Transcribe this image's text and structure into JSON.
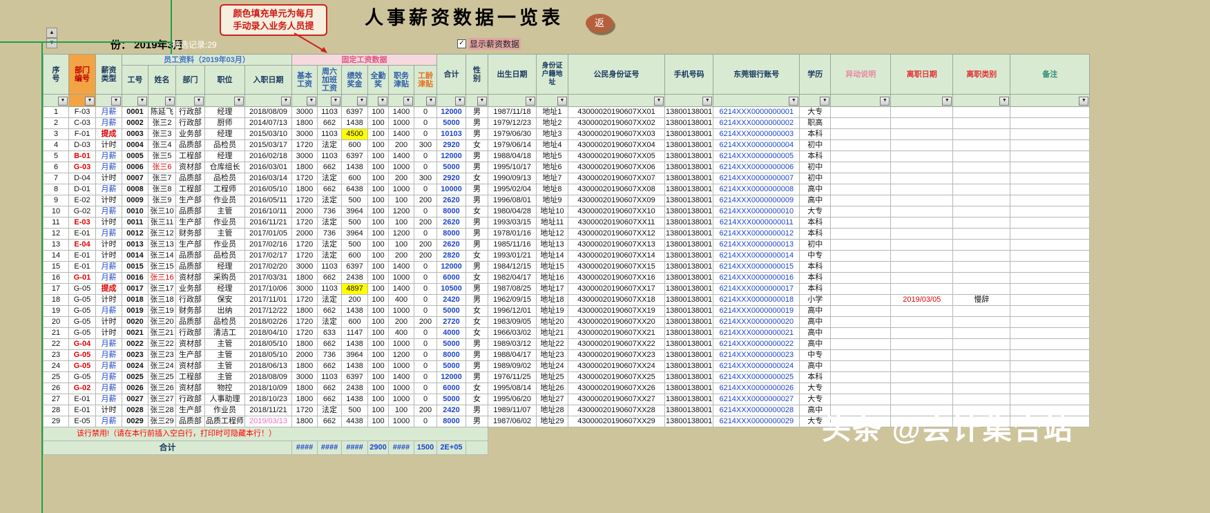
{
  "page": {
    "title": "人事薪资数据一览表",
    "return_button": "返",
    "watermark": "头条 @会计集合站",
    "callout": {
      "line1": "颜色填充单元为每月",
      "line2": "手动录入业务人员提"
    }
  },
  "controls": {
    "month_label": "份：  2019年3月",
    "filter_record": "筛选记录:29",
    "checkbox_label": "显示薪资数据",
    "checkbox_checked": true
  },
  "table": {
    "group_headers": {
      "employee": "员工资料（2019年03月）",
      "fixed_salary": "固定工资数据"
    },
    "columns": [
      "序\n号",
      "部门\n编号",
      "薪资\n类型",
      "工号",
      "姓名",
      "部门",
      "职位",
      "入职日期",
      "基本\n工资",
      "周六\n加班\n工资",
      "绩效\n奖金",
      "全勤\n奖",
      "职务\n津贴",
      "工龄\n津贴",
      "合计",
      "性\n别",
      "出生日期",
      "身份证\n户籍地\n址",
      "公民身份证号",
      "手机号码",
      "东莞银行账号",
      "学历",
      "异动说明",
      "离职日期",
      "离职类别",
      "备注"
    ],
    "rows": [
      [
        "1",
        "F-03",
        "月薪",
        "0001",
        "陈延飞",
        "行政部",
        "经理",
        "2018/08/09",
        "3000",
        "1103",
        "6397",
        "100",
        "1400",
        "0",
        "12000",
        "男",
        "1987/11/18",
        "地址1",
        "43000020190607XX01",
        "13800138001",
        "6214XXX0000000001",
        "大专",
        "",
        "",
        "",
        ""
      ],
      [
        "2",
        "C-03",
        "月薪",
        "0002",
        "张三2",
        "行政部",
        "厨师",
        "2014/07/13",
        "1800",
        "662",
        "1438",
        "100",
        "1000",
        "0",
        "5000",
        "男",
        "1979/12/23",
        "地址2",
        "43000020190607XX02",
        "13800138001",
        "6214XXX0000000002",
        "职高",
        "",
        "",
        "",
        ""
      ],
      [
        "3",
        "F-01",
        "提成",
        "0003",
        "张三3",
        "业务部",
        "经理",
        "2015/03/10",
        "3000",
        "1103",
        "4500",
        "100",
        "1400",
        "0",
        "10103",
        "男",
        "1979/06/30",
        "地址3",
        "43000020190607XX03",
        "13800138001",
        "6214XXX0000000003",
        "本科",
        "",
        "",
        "",
        ""
      ],
      [
        "4",
        "D-03",
        "计时",
        "0004",
        "张三4",
        "品质部",
        "品检员",
        "2015/03/17",
        "1720",
        "法定",
        "600",
        "100",
        "200",
        "300",
        "2920",
        "女",
        "1979/06/14",
        "地址4",
        "43000020190607XX04",
        "13800138001",
        "6214XXX0000000004",
        "初中",
        "",
        "",
        "",
        ""
      ],
      [
        "5",
        "B-01",
        "月薪",
        "0005",
        "张三5",
        "工程部",
        "经理",
        "2016/02/18",
        "3000",
        "1103",
        "6397",
        "100",
        "1400",
        "0",
        "12000",
        "男",
        "1988/04/18",
        "地址5",
        "43000020190607XX05",
        "13800138001",
        "6214XXX0000000005",
        "本科",
        "",
        "",
        "",
        ""
      ],
      [
        "6",
        "G-03",
        "月薪",
        "0006",
        "张三6",
        "资材部",
        "仓库组长",
        "2016/03/01",
        "1800",
        "662",
        "1438",
        "100",
        "1000",
        "0",
        "5000",
        "男",
        "1995/10/17",
        "地址6",
        "43000020190607XX06",
        "13800138001",
        "6214XXX0000000006",
        "初中",
        "",
        "",
        "",
        ""
      ],
      [
        "7",
        "D-04",
        "计时",
        "0007",
        "张三7",
        "品质部",
        "品检员",
        "2016/03/14",
        "1720",
        "法定",
        "600",
        "100",
        "200",
        "300",
        "2920",
        "女",
        "1990/09/13",
        "地址7",
        "43000020190607XX07",
        "13800138001",
        "6214XXX0000000007",
        "初中",
        "",
        "",
        "",
        ""
      ],
      [
        "8",
        "D-01",
        "月薪",
        "0008",
        "张三8",
        "工程部",
        "工程师",
        "2016/05/10",
        "1800",
        "662",
        "6438",
        "100",
        "1000",
        "0",
        "10000",
        "男",
        "1995/02/04",
        "地址8",
        "43000020190607XX08",
        "13800138001",
        "6214XXX0000000008",
        "高中",
        "",
        "",
        "",
        ""
      ],
      [
        "9",
        "E-02",
        "计时",
        "0009",
        "张三9",
        "生产部",
        "作业员",
        "2016/05/11",
        "1720",
        "法定",
        "500",
        "100",
        "100",
        "200",
        "2620",
        "男",
        "1996/08/01",
        "地址9",
        "43000020190607XX09",
        "13800138001",
        "6214XXX0000000009",
        "高中",
        "",
        "",
        "",
        ""
      ],
      [
        "10",
        "G-02",
        "月薪",
        "0010",
        "张三10",
        "品质部",
        "主管",
        "2016/10/11",
        "2000",
        "736",
        "3964",
        "100",
        "1200",
        "0",
        "8000",
        "女",
        "1980/04/28",
        "地址10",
        "43000020190607XX10",
        "13800138001",
        "6214XXX0000000010",
        "大专",
        "",
        "",
        "",
        ""
      ],
      [
        "11",
        "E-03",
        "计时",
        "0011",
        "张三11",
        "生产部",
        "作业员",
        "2016/11/21",
        "1720",
        "法定",
        "500",
        "100",
        "100",
        "200",
        "2620",
        "男",
        "1993/03/15",
        "地址11",
        "43000020190607XX11",
        "13800138001",
        "6214XXX0000000011",
        "本科",
        "",
        "",
        "",
        ""
      ],
      [
        "12",
        "E-01",
        "月薪",
        "0012",
        "张三12",
        "财务部",
        "主管",
        "2017/01/05",
        "2000",
        "736",
        "3964",
        "100",
        "1200",
        "0",
        "8000",
        "男",
        "1978/01/16",
        "地址12",
        "43000020190607XX12",
        "13800138001",
        "6214XXX0000000012",
        "本科",
        "",
        "",
        "",
        ""
      ],
      [
        "13",
        "E-04",
        "计时",
        "0013",
        "张三13",
        "生产部",
        "作业员",
        "2017/02/16",
        "1720",
        "法定",
        "500",
        "100",
        "100",
        "200",
        "2620",
        "男",
        "1985/11/16",
        "地址13",
        "43000020190607XX13",
        "13800138001",
        "6214XXX0000000013",
        "初中",
        "",
        "",
        "",
        ""
      ],
      [
        "14",
        "E-01",
        "计时",
        "0014",
        "张三14",
        "品质部",
        "品检员",
        "2017/02/17",
        "1720",
        "法定",
        "600",
        "100",
        "200",
        "200",
        "2820",
        "女",
        "1993/01/21",
        "地址14",
        "43000020190607XX14",
        "13800138001",
        "6214XXX0000000014",
        "中专",
        "",
        "",
        "",
        ""
      ],
      [
        "15",
        "E-01",
        "月薪",
        "0015",
        "张三15",
        "品质部",
        "经理",
        "2017/02/20",
        "3000",
        "1103",
        "6397",
        "100",
        "1400",
        "0",
        "12000",
        "男",
        "1984/12/15",
        "地址15",
        "43000020190607XX15",
        "13800138001",
        "6214XXX0000000015",
        "本科",
        "",
        "",
        "",
        ""
      ],
      [
        "16",
        "G-01",
        "月薪",
        "0016",
        "张三16",
        "资材部",
        "采购员",
        "2017/03/31",
        "1800",
        "662",
        "2438",
        "100",
        "1000",
        "0",
        "6000",
        "女",
        "1982/04/17",
        "地址16",
        "43000020190607XX16",
        "13800138001",
        "6214XXX0000000016",
        "本科",
        "",
        "",
        "",
        ""
      ],
      [
        "17",
        "G-05",
        "提成",
        "0017",
        "张三17",
        "业务部",
        "经理",
        "2017/10/06",
        "3000",
        "1103",
        "4897",
        "100",
        "1400",
        "0",
        "10500",
        "男",
        "1987/08/25",
        "地址17",
        "43000020190607XX17",
        "13800138001",
        "6214XXX0000000017",
        "本科",
        "",
        "",
        "",
        ""
      ],
      [
        "18",
        "G-05",
        "计时",
        "0018",
        "张三18",
        "行政部",
        "保安",
        "2017/11/01",
        "1720",
        "法定",
        "200",
        "100",
        "400",
        "0",
        "2420",
        "男",
        "1962/09/15",
        "地址18",
        "43000020190607XX18",
        "13800138001",
        "6214XXX0000000018",
        "小学",
        "",
        "2019/03/05",
        "慢辞",
        ""
      ],
      [
        "19",
        "G-05",
        "月薪",
        "0019",
        "张三19",
        "财务部",
        "出纳",
        "2017/12/22",
        "1800",
        "662",
        "1438",
        "100",
        "1000",
        "0",
        "5000",
        "女",
        "1996/12/01",
        "地址19",
        "43000020190607XX19",
        "13800138001",
        "6214XXX0000000019",
        "高中",
        "",
        "",
        "",
        ""
      ],
      [
        "20",
        "G-05",
        "计时",
        "0020",
        "张三20",
        "品质部",
        "品检员",
        "2018/02/26",
        "1720",
        "法定",
        "600",
        "100",
        "200",
        "200",
        "2720",
        "女",
        "1983/09/05",
        "地址20",
        "43000020190607XX20",
        "13800138001",
        "6214XXX0000000020",
        "高中",
        "",
        "",
        "",
        ""
      ],
      [
        "21",
        "G-05",
        "计时",
        "0021",
        "张三21",
        "行政部",
        "清洁工",
        "2018/04/10",
        "1720",
        "633",
        "1147",
        "100",
        "400",
        "0",
        "4000",
        "女",
        "1966/03/02",
        "地址21",
        "43000020190607XX21",
        "13800138001",
        "6214XXX0000000021",
        "高中",
        "",
        "",
        "",
        ""
      ],
      [
        "22",
        "G-04",
        "月薪",
        "0022",
        "张三22",
        "资材部",
        "主管",
        "2018/05/10",
        "1800",
        "662",
        "1438",
        "100",
        "1000",
        "0",
        "5000",
        "男",
        "1989/03/12",
        "地址22",
        "43000020190607XX22",
        "13800138001",
        "6214XXX0000000022",
        "高中",
        "",
        "",
        "",
        ""
      ],
      [
        "23",
        "G-05",
        "月薪",
        "0023",
        "张三23",
        "生产部",
        "主管",
        "2018/05/10",
        "2000",
        "736",
        "3964",
        "100",
        "1200",
        "0",
        "8000",
        "男",
        "1988/04/17",
        "地址23",
        "43000020190607XX23",
        "13800138001",
        "6214XXX0000000023",
        "中专",
        "",
        "",
        "",
        ""
      ],
      [
        "24",
        "G-05",
        "月薪",
        "0024",
        "张三24",
        "资材部",
        "主管",
        "2018/06/13",
        "1800",
        "662",
        "1438",
        "100",
        "1000",
        "0",
        "5000",
        "男",
        "1989/09/02",
        "地址24",
        "43000020190607XX24",
        "13800138001",
        "6214XXX0000000024",
        "高中",
        "",
        "",
        "",
        ""
      ],
      [
        "25",
        "G-05",
        "月薪",
        "0025",
        "张三25",
        "工程部",
        "主管",
        "2018/08/09",
        "3000",
        "1103",
        "6397",
        "100",
        "1400",
        "0",
        "12000",
        "男",
        "1976/11/25",
        "地址25",
        "43000020190607XX25",
        "13800138001",
        "6214XXX0000000025",
        "本科",
        "",
        "",
        "",
        ""
      ],
      [
        "26",
        "G-02",
        "月薪",
        "0026",
        "张三26",
        "资材部",
        "物控",
        "2018/10/09",
        "1800",
        "662",
        "2438",
        "100",
        "1000",
        "0",
        "6000",
        "女",
        "1995/08/14",
        "地址26",
        "43000020190607XX26",
        "13800138001",
        "6214XXX0000000026",
        "大专",
        "",
        "",
        "",
        ""
      ],
      [
        "27",
        "E-01",
        "月薪",
        "0027",
        "张三27",
        "行政部",
        "人事助理",
        "2018/10/23",
        "1800",
        "662",
        "1438",
        "100",
        "1000",
        "0",
        "5000",
        "女",
        "1995/06/20",
        "地址27",
        "43000020190607XX27",
        "13800138001",
        "6214XXX0000000027",
        "大专",
        "",
        "",
        "",
        ""
      ],
      [
        "28",
        "E-01",
        "计时",
        "0028",
        "张三28",
        "生产部",
        "作业员",
        "2018/11/21",
        "1720",
        "法定",
        "500",
        "100",
        "100",
        "200",
        "2420",
        "男",
        "1989/11/07",
        "地址28",
        "43000020190607XX28",
        "13800138001",
        "6214XXX0000000028",
        "高中",
        "",
        "",
        "",
        ""
      ],
      [
        "29",
        "E-05",
        "月薪",
        "0029",
        "张三29",
        "品质部",
        "品质工程师",
        "2019/03/13",
        "1800",
        "662",
        "4438",
        "100",
        "1000",
        "0",
        "8000",
        "男",
        "1987/06/02",
        "地址29",
        "43000020190607XX29",
        "13800138001",
        "6214XXX0000000029",
        "大专",
        "",
        "",
        "",
        ""
      ]
    ],
    "styles": {
      "red_dept_rows": [
        5,
        6,
        11,
        13,
        16,
        22,
        23,
        24,
        26
      ],
      "red_name_rows": [
        6,
        16
      ],
      "yellow_perf_rows": [
        3,
        17
      ],
      "pink_hire_rows": [
        29
      ],
      "red_leave_date_rows": [
        18
      ]
    },
    "footer": {
      "disabled_note": "该行禁用!（请在本行前插入空白行，打印时可隐藏本行！）",
      "total_label": "合计",
      "totals": [
        "####",
        "####",
        "####",
        "2900",
        "####",
        "1500",
        "2E+05"
      ]
    }
  }
}
